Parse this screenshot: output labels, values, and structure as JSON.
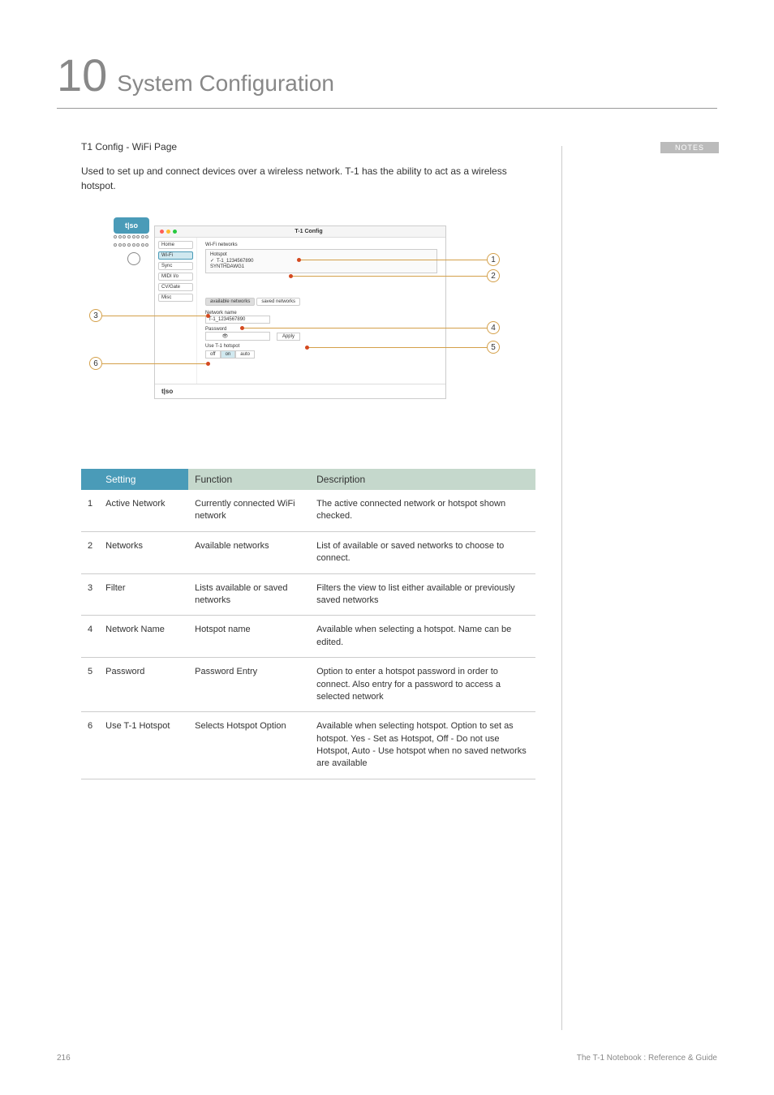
{
  "chapter": {
    "number": "10",
    "title": "System Configuration"
  },
  "notes_label": "NOTES",
  "section": {
    "title": "T1 Config - WiFi Page",
    "intro": "Used to set up and connect devices over a wireless network. T-1 has the ability to act as a wireless hotspot."
  },
  "device_logo": "t|so",
  "app": {
    "title": "T-1 Config",
    "sidebar": [
      "Home",
      "Wi-Fi",
      "Sync",
      "MIDI I/o",
      "CV/Gate",
      "Misc"
    ],
    "sidebar_active_index": 1,
    "main_label": "Wi-Fi networks",
    "net_hotspot_label": "Hotspot",
    "net_active": "T-1_1234567890",
    "net_other": "SYNTHDAWG1",
    "filter_available": "available networks",
    "filter_saved": "saved networks",
    "field_network_name_label": "Network name",
    "field_network_name_value": "T-1_1234567890",
    "field_password_label": "Password",
    "apply_label": "Apply",
    "hotspot_label": "Use T-1 hotspot",
    "hotspot_options": [
      "off",
      "on",
      "auto"
    ],
    "footer_logo": "t|so"
  },
  "callouts": [
    "1",
    "2",
    "3",
    "4",
    "5",
    "6"
  ],
  "table": {
    "headers": {
      "setting": "Setting",
      "function": "Function",
      "description": "Description"
    },
    "rows": [
      {
        "n": "1",
        "setting": "Active Network",
        "func": "Currently connected WiFi network",
        "desc": "The active connected network or hotspot shown checked."
      },
      {
        "n": "2",
        "setting": "Networks",
        "func": "Available networks",
        "desc": "List of available or saved networks to choose to connect."
      },
      {
        "n": "3",
        "setting": "Filter",
        "func": "Lists available or saved networks",
        "desc": "Filters the view to list either available or previously saved networks"
      },
      {
        "n": "4",
        "setting": "Network Name",
        "func": "Hotspot name",
        "desc": "Available when selecting a hotspot. Name can be edited."
      },
      {
        "n": "5",
        "setting": "Password",
        "func": "Password Entry",
        "desc": "Option to enter a hotspot password in order to connect. Also entry for a password to access a selected network"
      },
      {
        "n": "6",
        "setting": "Use T-1 Hotspot",
        "func": "Selects Hotspot Option",
        "desc": "Available when selecting hotspot. Option to set as hotspot. Yes - Set as Hotspot, Off - Do not use Hotspot, Auto - Use hotspot when no saved networks are available"
      }
    ]
  },
  "footer": {
    "page": "216",
    "doc": "The T-1 Notebook : Reference & Guide"
  }
}
